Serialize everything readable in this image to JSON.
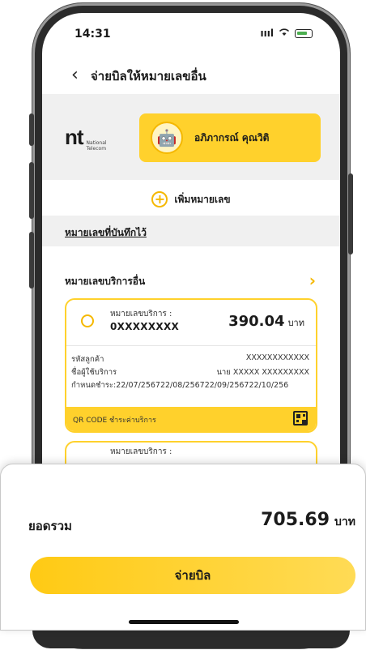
{
  "status_bar": {
    "time": "14:31",
    "signal": "ıııl"
  },
  "header": {
    "back_glyph": "‹",
    "title": "จ่ายบิลให้หมายเลขอื่น"
  },
  "provider": {
    "logo_text": "nt",
    "logo_subtitle_1": "National",
    "logo_subtitle_2": "Telecom",
    "device_name": "อภิภากรณ์ คุณวิติ"
  },
  "add_number": {
    "label": "เพิ่มหมายเลข"
  },
  "saved": {
    "title": "หมายเลขที่บันทึกไว้"
  },
  "other_services": {
    "title": "หมายเลขบริการอื่น"
  },
  "bills": [
    {
      "service_label": "หมายเลขบริการ :",
      "service_number": "0XXXXXXXX",
      "amount": "390.04",
      "unit": "บาท",
      "customer_id_label": "รหัสลูกค้า",
      "customer_id_value": "XXXXXXXXXXXX",
      "user_label": "ชื่อผู้ใช้บริการ",
      "user_value": "นาย XXXXX XXXXXXXXX",
      "due_text": "กำหนดชำระ:22/07/256722/08/256722/09/256722/10/256",
      "qr_label": "QR CODE ชำระค่าบริการ"
    },
    {
      "service_label": "หมายเลขบริการ :"
    }
  ],
  "summary": {
    "total_label": "ยอดรวม",
    "total_value": "705.69",
    "total_unit": "บาท",
    "pay_label": "จ่ายบิล"
  }
}
